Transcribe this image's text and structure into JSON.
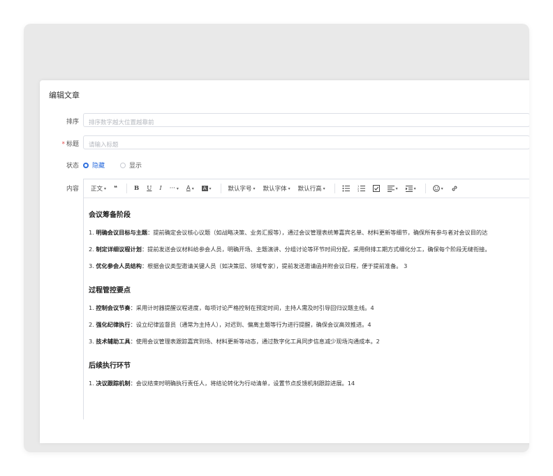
{
  "form": {
    "title": "编辑文章",
    "sort_label": "排序",
    "sort_placeholder": "排序数字越大位置越靠前",
    "required_mark": "*",
    "title_label": "标题",
    "title_placeholder": "请输入标题",
    "status_label": "状态",
    "status_options": [
      {
        "label": "隐藏",
        "checked": true
      },
      {
        "label": "显示",
        "checked": false
      }
    ],
    "content_label": "内容"
  },
  "toolbar": {
    "paragraph": "正文",
    "quote": "❝",
    "bold": "B",
    "underline": "U",
    "italic": "I",
    "more": "···",
    "font_color": "A",
    "bg_color": "A",
    "font_size": "默认字号",
    "font_family": "默认字体",
    "line_height": "默认行高",
    "icons": [
      "bulleted-list-icon",
      "numbered-list-icon",
      "todo-icon",
      "align-icon",
      "indent-icon",
      "emoji-icon",
      "link-icon"
    ]
  },
  "content": {
    "sections": [
      {
        "heading": "会议筹备阶段",
        "items": [
          {
            "num": "1.",
            "bold": "明确会议目标与主题",
            "text": "：提前确定会议核心议题（如战略决策、业务汇报等），通过会议管理表统筹嘉宾名单、材料更新等细节，确保所有参与者对会议目的达"
          },
          {
            "num": "2.",
            "bold": "制定详细议程计划",
            "text": "：提前发送会议材料给参会人员，明确开场、主题演讲、分组讨论等环节时间分配，采用倒排工期方式细化分工，确保每个阶段无缝衔接。"
          },
          {
            "num": "3.",
            "bold": "优化参会人员结构",
            "text": "：根据会议类型邀请关键人员（如决策层、领域专家），提前发送邀请函并附会议日程，便于提前准备。 3"
          }
        ]
      },
      {
        "heading": "过程管控要点",
        "items": [
          {
            "num": "1.",
            "bold": "控制会议节奏",
            "text": "：采用计时器提醒议程进度，每项讨论严格控制在预定时间，主持人需及时引导回归议题主线。4"
          },
          {
            "num": "2.",
            "bold": "强化纪律执行",
            "text": "：设立纪律监督员（通常为主持人），对迟到、偏离主题等行为进行提醒，确保会议高效推进。4"
          },
          {
            "num": "3.",
            "bold": "技术辅助工具",
            "text": "：使用会议管理表跟踪嘉宾到场、材料更新等动态，通过数字化工具同步信息减少现场沟通成本。2"
          }
        ]
      },
      {
        "heading": "后续执行环节",
        "items": [
          {
            "num": "1.",
            "bold": "决议跟踪机制",
            "text": "：会议结束时明确执行责任人，将结论转化为行动清单，设置节点反馈机制跟踪进展。14"
          }
        ]
      }
    ]
  },
  "colors": {
    "accent": "#2f6fde",
    "required": "#e24c4c"
  }
}
